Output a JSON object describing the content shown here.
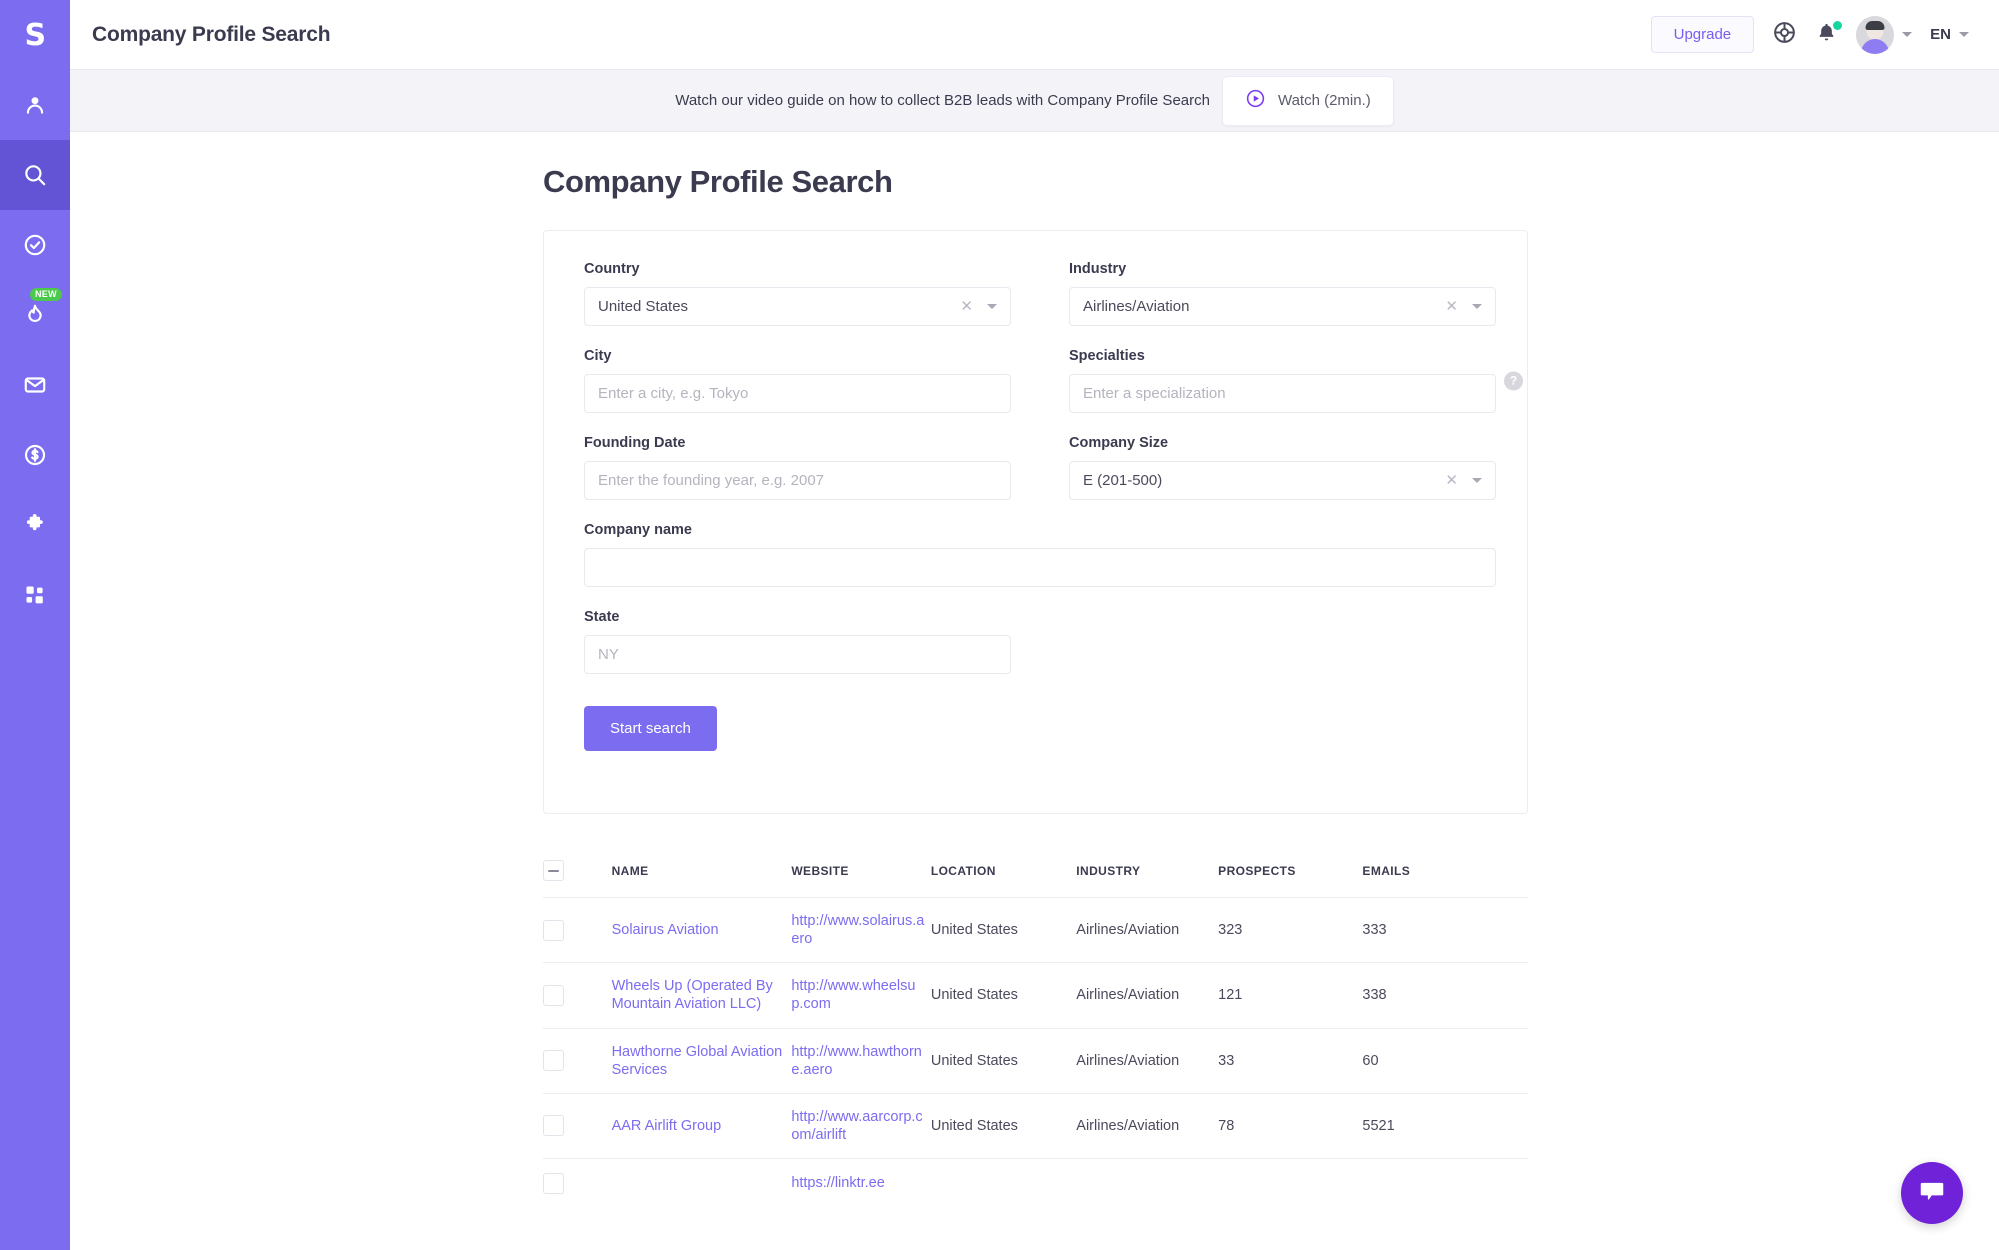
{
  "brand": {
    "logo_letter": "S",
    "sidebar_color": "#7b6cf0",
    "active_color": "#6354d6",
    "accent": "#7b6cf0"
  },
  "sidebar": {
    "items": [
      {
        "icon": "person-icon",
        "active": false
      },
      {
        "icon": "search-icon",
        "active": true
      },
      {
        "icon": "check-circle-icon",
        "active": false
      },
      {
        "icon": "flame-icon",
        "active": false,
        "badge": "NEW"
      },
      {
        "icon": "envelope-icon",
        "active": false
      },
      {
        "icon": "dollar-circle-icon",
        "active": false
      },
      {
        "icon": "puzzle-icon",
        "active": false
      },
      {
        "icon": "grid-icon",
        "active": false
      }
    ]
  },
  "topbar": {
    "title": "Company Profile Search",
    "upgrade_label": "Upgrade",
    "language": "EN",
    "notification_dot_color": "#15d6a0"
  },
  "banner": {
    "text": "Watch our video guide on how to collect B2B leads with Company Profile Search",
    "watch_label": "Watch (2min.)"
  },
  "page": {
    "title": "Company Profile Search"
  },
  "form": {
    "country": {
      "label": "Country",
      "value": "United States",
      "placeholder": ""
    },
    "industry": {
      "label": "Industry",
      "value": "Airlines/Aviation",
      "placeholder": ""
    },
    "city": {
      "label": "City",
      "value": "",
      "placeholder": "Enter a city, e.g. Tokyo"
    },
    "specialties": {
      "label": "Specialties",
      "value": "",
      "placeholder": "Enter a specialization",
      "help": "?"
    },
    "founding_date": {
      "label": "Founding Date",
      "value": "",
      "placeholder": "Enter the founding year, e.g. 2007"
    },
    "company_size": {
      "label": "Company Size",
      "value": "E (201-500)",
      "placeholder": ""
    },
    "company_name": {
      "label": "Company name",
      "value": "",
      "placeholder": ""
    },
    "state": {
      "label": "State",
      "value": "",
      "placeholder": "NY"
    },
    "submit_label": "Start search"
  },
  "table": {
    "headers": [
      "NAME",
      "WEBSITE",
      "LOCATION",
      "INDUSTRY",
      "PROSPECTS",
      "EMAILS"
    ],
    "rows": [
      {
        "name": "Solairus Aviation",
        "website": "http://www.solairus.aero",
        "location": "United States",
        "industry": "Airlines/Aviation",
        "prospects": "323",
        "emails": "333"
      },
      {
        "name": "Wheels Up (Operated By Mountain Aviation LLC)",
        "website": "http://www.wheelsup.com",
        "location": "United States",
        "industry": "Airlines/Aviation",
        "prospects": "121",
        "emails": "338"
      },
      {
        "name": "Hawthorne Global Aviation Services",
        "website": "http://www.hawthorne.aero",
        "location": "United States",
        "industry": "Airlines/Aviation",
        "prospects": "33",
        "emails": "60"
      },
      {
        "name": "AAR Airlift Group",
        "website": "http://www.aarcorp.com/airlift",
        "location": "United States",
        "industry": "Airlines/Aviation",
        "prospects": "78",
        "emails": "5521"
      }
    ],
    "partial_row": {
      "website": "https://linktr.ee"
    }
  },
  "chat": {
    "icon": "chat-bubble-icon",
    "color": "#6f22d8"
  }
}
